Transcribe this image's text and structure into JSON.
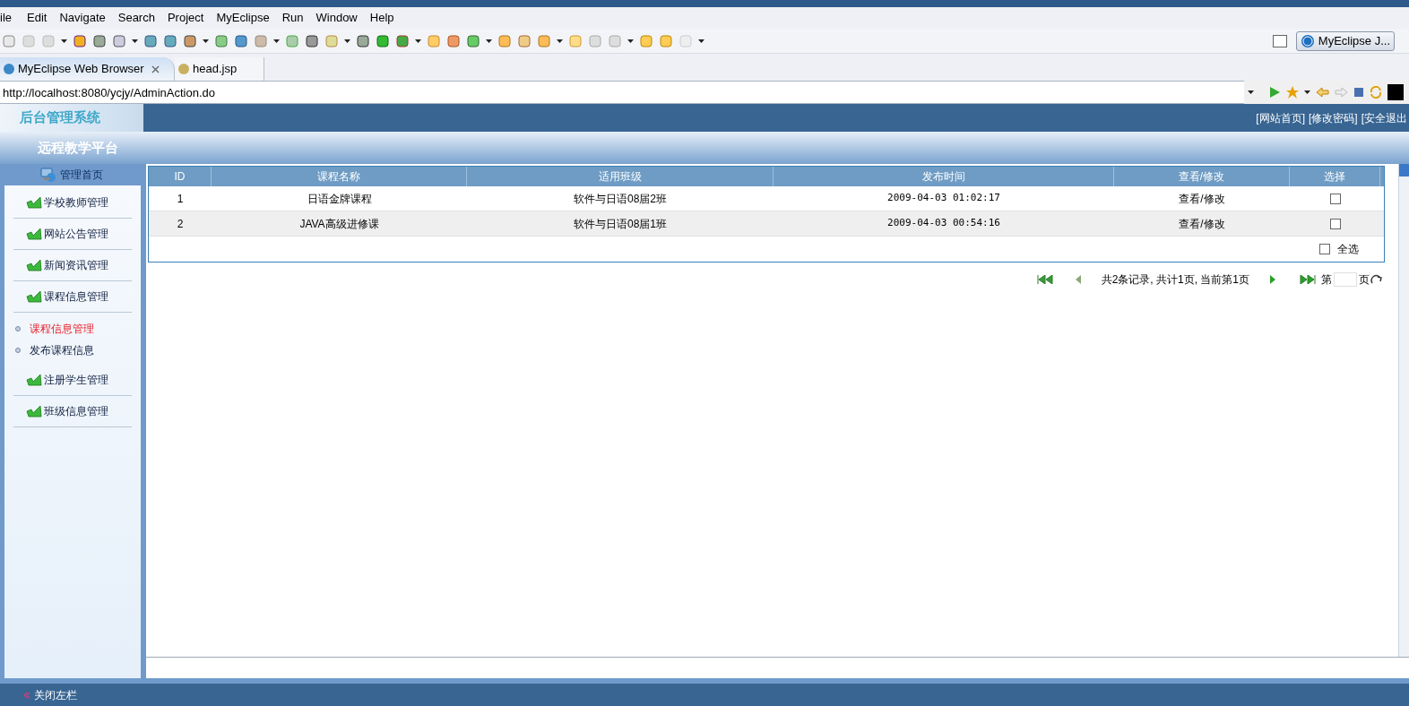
{
  "menu": [
    "ile",
    "Edit",
    "Navigate",
    "Search",
    "Project",
    "MyEclipse",
    "Run",
    "Window",
    "Help"
  ],
  "perspective_button": "MyEclipse J...",
  "editor_tabs": [
    {
      "label": "MyEclipse Web Browser",
      "selected": true
    },
    {
      "label": "head.jsp",
      "selected": false
    }
  ],
  "address": "http://localhost:8080/ycjy/AdminAction.do",
  "page": {
    "logo": "后台管理系统",
    "subtitle": "远程教学平台",
    "top_links": [
      "[网站首页]",
      "[修改密码]",
      "[安全退出"
    ]
  },
  "sidebar": {
    "home": "管理首页",
    "items": [
      {
        "label": "学校教师管理"
      },
      {
        "label": "网站公告管理"
      },
      {
        "label": "新闻资讯管理"
      },
      {
        "label": "课程信息管理",
        "children": [
          {
            "label": "课程信息管理",
            "selected": true
          },
          {
            "label": "发布课程信息",
            "selected": false
          }
        ]
      },
      {
        "label": "注册学生管理"
      },
      {
        "label": "班级信息管理"
      }
    ]
  },
  "table": {
    "columns": [
      "ID",
      "课程名称",
      "适用班级",
      "发布时间",
      "查看/修改",
      "选择"
    ],
    "rows": [
      {
        "cells": [
          "1",
          "日语金牌课程",
          "软件与日语08届2班",
          "2009-04-03 01:02:17"
        ],
        "action": "查看/修改",
        "checked": false
      },
      {
        "cells": [
          "2",
          "JAVA高级进修课",
          "软件与日语08届1班",
          "2009-04-03 00:54:16"
        ],
        "action": "查看/修改",
        "checked": false
      }
    ],
    "select_all": {
      "label": "全选",
      "checked": false
    }
  },
  "pager": {
    "summary": "共2条记录, 共计1页, 当前第1页",
    "page_prefix": "第",
    "page_suffix": "页"
  },
  "footer": "关闭左栏"
}
